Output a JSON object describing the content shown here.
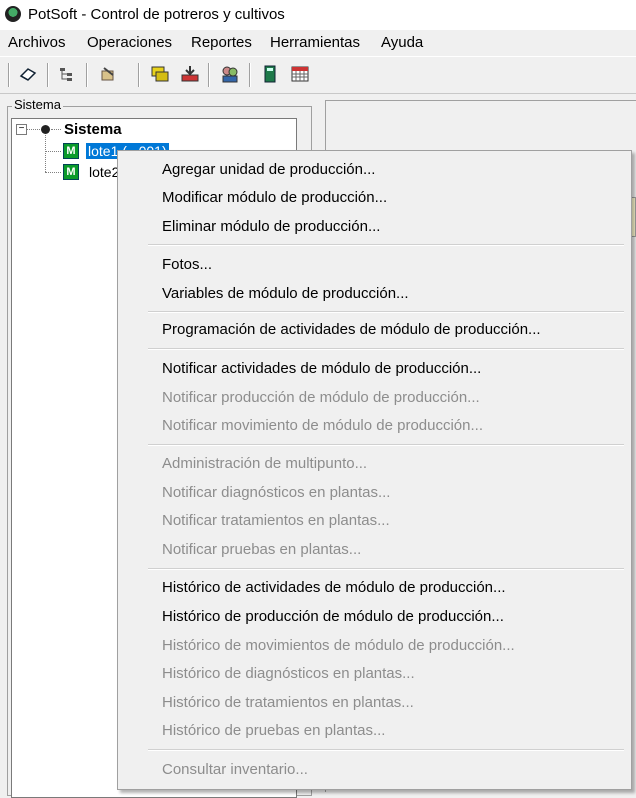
{
  "window": {
    "title": "PotSoft - Control de potreros y cultivos"
  },
  "menubar": {
    "items": [
      "Archivos",
      "Operaciones",
      "Reportes",
      "Herramientas",
      "Ayuda"
    ]
  },
  "toolbar": {
    "buttons": [
      "open-icon",
      "tree-icon",
      "edit-icon",
      "chat-icon",
      "download-icon",
      "users-icon",
      "calculator-icon",
      "calendar-icon"
    ]
  },
  "tree": {
    "group_label": "Sistema",
    "root": "Sistema",
    "nodes": [
      {
        "label": "lote1 (...001)",
        "selected": true
      },
      {
        "label": "lote2"
      }
    ],
    "expander": "−"
  },
  "context_menu": {
    "items": [
      {
        "label": "Agregar unidad de producción...",
        "enabled": true
      },
      {
        "label": "Modificar módulo de producción...",
        "enabled": true
      },
      {
        "label": "Eliminar módulo de producción...",
        "enabled": true
      },
      {
        "label": "Fotos...",
        "enabled": true
      },
      {
        "label": "Variables de módulo de producción...",
        "enabled": true
      },
      {
        "label": "Programación de actividades de módulo de producción...",
        "enabled": true
      },
      {
        "label": "Notificar actividades de módulo de producción...",
        "enabled": true
      },
      {
        "label": "Notificar producción de módulo de producción...",
        "enabled": false
      },
      {
        "label": "Notificar movimiento de módulo de producción...",
        "enabled": false
      },
      {
        "label": "Administración de multipunto...",
        "enabled": false
      },
      {
        "label": "Notificar diagnósticos en plantas...",
        "enabled": false
      },
      {
        "label": "Notificar tratamientos en plantas...",
        "enabled": false
      },
      {
        "label": "Notificar pruebas en plantas...",
        "enabled": false
      },
      {
        "label": "Histórico de actividades de módulo de producción...",
        "enabled": true
      },
      {
        "label": "Histórico de producción de módulo de producción...",
        "enabled": true
      },
      {
        "label": "Histórico de movimientos de módulo de producción...",
        "enabled": false
      },
      {
        "label": "Histórico de diagnósticos en plantas...",
        "enabled": false
      },
      {
        "label": "Histórico de tratamientos en plantas...",
        "enabled": false
      },
      {
        "label": "Histórico de pruebas en plantas...",
        "enabled": false
      },
      {
        "label": "Consultar inventario...",
        "enabled": false
      }
    ]
  },
  "colors": {
    "selection": "#0078d7",
    "disabled_text": "#8d8d8d",
    "lote_icon": "#0a9a2a"
  }
}
